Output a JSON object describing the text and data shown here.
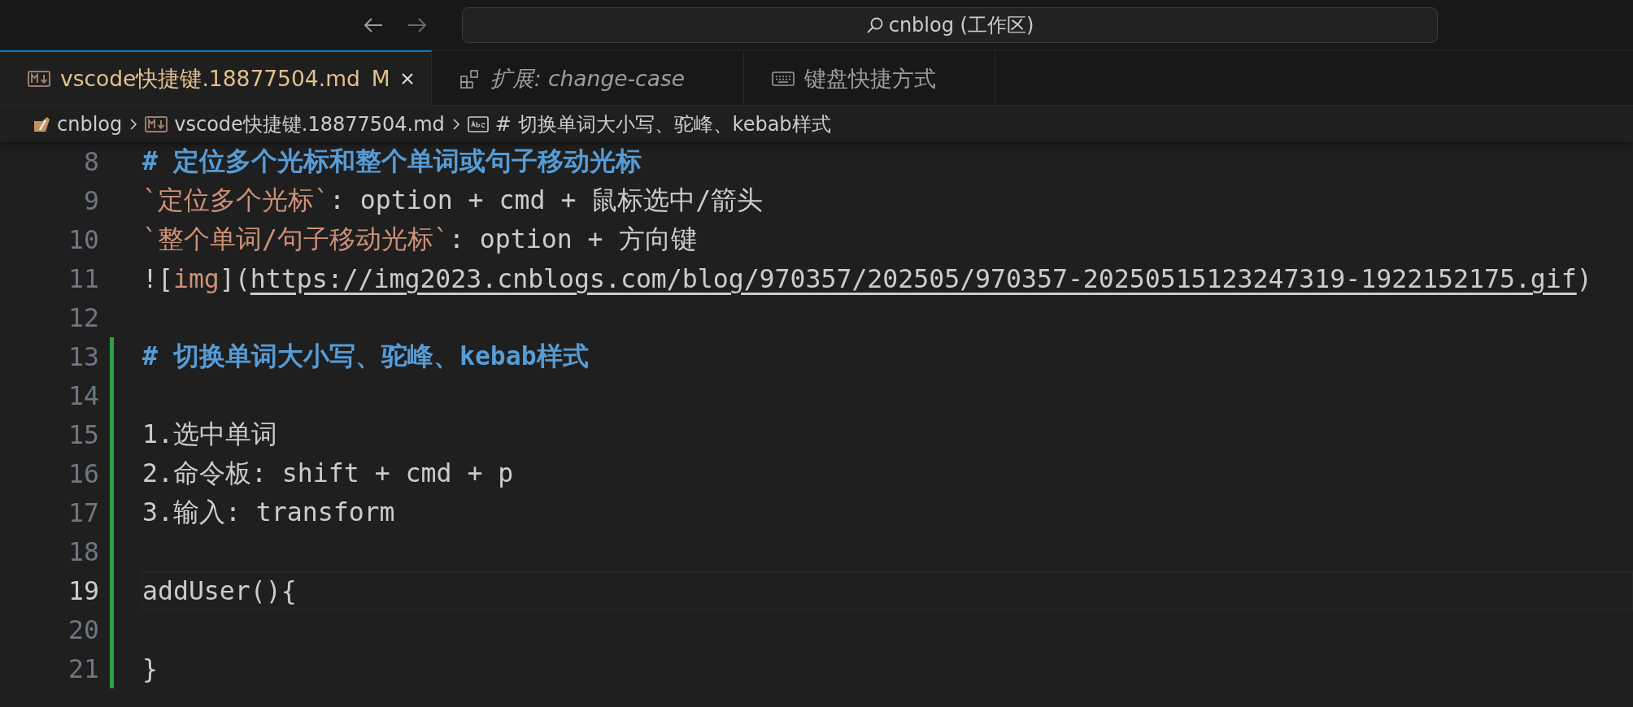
{
  "window": {
    "search": "cnblog (工作区)"
  },
  "tabs": [
    {
      "label": "vscode快捷键.18877504.md",
      "kind": "markdown",
      "badge": "M",
      "selected": true,
      "preview": false
    },
    {
      "label": "扩展: change-case",
      "kind": "extension",
      "selected": false,
      "preview": true
    },
    {
      "label": "键盘快捷方式",
      "kind": "keyboard",
      "selected": false,
      "preview": false
    }
  ],
  "breadcrumb": [
    {
      "label": "cnblog",
      "kind": "folder"
    },
    {
      "label": "vscode快捷键.18877504.md",
      "kind": "markdown"
    },
    {
      "label": "# 切换单词大小写、驼峰、kebab样式",
      "kind": "symbol"
    }
  ],
  "editor": {
    "lines": [
      {
        "number": "8",
        "modified": false,
        "current": false,
        "segments": [
          {
            "kind": "heading",
            "text": "# 定位多个光标和整个单词或句子移动光标"
          }
        ]
      },
      {
        "number": "9",
        "modified": false,
        "current": false,
        "segments": [
          {
            "kind": "code",
            "text": "`定位多个光标`"
          },
          {
            "kind": "plain",
            "text": ": option + cmd + 鼠标选中/箭头"
          }
        ]
      },
      {
        "number": "10",
        "modified": false,
        "current": false,
        "segments": [
          {
            "kind": "code",
            "text": "`整个单词/句子移动光标`"
          },
          {
            "kind": "plain",
            "text": ": option + 方向键"
          }
        ]
      },
      {
        "number": "11",
        "modified": false,
        "current": false,
        "segments": [
          {
            "kind": "plain",
            "text": "!["
          },
          {
            "kind": "code",
            "text": "img"
          },
          {
            "kind": "plain",
            "text": "]("
          },
          {
            "kind": "url",
            "text": "https://img2023.cnblogs.com/blog/970357/202505/970357-20250515123247319-1922152175.gif"
          },
          {
            "kind": "plain",
            "text": ")"
          }
        ]
      },
      {
        "number": "12",
        "modified": false,
        "current": false
      },
      {
        "number": "13",
        "modified": true,
        "current": false,
        "segments": [
          {
            "kind": "heading",
            "text": "# 切换单词大小写、驼峰、kebab样式"
          }
        ]
      },
      {
        "number": "14",
        "modified": true,
        "current": false
      },
      {
        "number": "15",
        "modified": true,
        "current": false,
        "segments": [
          {
            "kind": "plain",
            "text": "1.选中单词"
          }
        ]
      },
      {
        "number": "16",
        "modified": true,
        "current": false,
        "segments": [
          {
            "kind": "plain",
            "text": "2.命令板: shift + cmd + p"
          }
        ]
      },
      {
        "number": "17",
        "modified": true,
        "current": false,
        "segments": [
          {
            "kind": "plain",
            "text": "3.输入: transform"
          }
        ]
      },
      {
        "number": "18",
        "modified": true,
        "current": false
      },
      {
        "number": "19",
        "modified": true,
        "current": true,
        "segments": [
          {
            "kind": "plain",
            "text": "addUser(){"
          }
        ]
      },
      {
        "number": "20",
        "modified": true,
        "current": false
      },
      {
        "number": "21",
        "modified": true,
        "current": false,
        "segments": [
          {
            "kind": "plain",
            "text": "}"
          }
        ]
      }
    ]
  }
}
